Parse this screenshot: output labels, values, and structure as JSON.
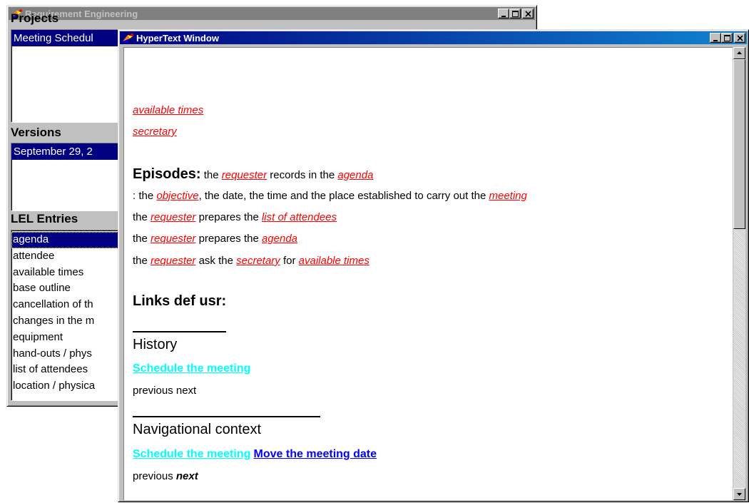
{
  "left_window": {
    "title": "Requirement Engineering",
    "projects_label": "Projects",
    "projects": [
      "Meeting Schedul"
    ],
    "versions_label": "Versions",
    "versions": [
      "September 29, 2"
    ],
    "lel_label": "LEL Entries",
    "lel_entries": [
      "agenda",
      "attendee",
      "available times",
      "base outline",
      "cancellation of th",
      "changes in the m",
      "equipment",
      "hand-outs / phys",
      "list of attendees",
      "location / physica"
    ]
  },
  "hypertext_window": {
    "title": "HyperText Window",
    "top_links": [
      "available times",
      "secretary"
    ],
    "episodes": {
      "label": "Episodes:",
      "line1": {
        "t1": " the ",
        "l1": "requester",
        "t2": " records in the ",
        "l2": "agenda"
      },
      "line2": {
        "t1": ": the ",
        "l1": "objective",
        "t2": ", the date, the time and the place established to carry out the ",
        "l2": "meeting"
      },
      "line3": {
        "t1": "the ",
        "l1": "requester",
        "t2": " prepares the ",
        "l2": "list of attendees"
      },
      "line4": {
        "t1": "the ",
        "l1": "requester",
        "t2": " prepares the ",
        "l2": "agenda"
      },
      "line5": {
        "t1": "the ",
        "l1": "requester",
        "t2": " ask the ",
        "l2": "secretary",
        "t3": " for ",
        "l3": "available times"
      }
    },
    "links_def_label": "Links def usr:",
    "history": {
      "heading": "History",
      "link": "Schedule the meeting",
      "prev": "previous",
      "next": "next"
    },
    "nav_context": {
      "heading": "Navigational context",
      "link1": "Schedule the meeting",
      "link2": "Move the meeting date",
      "prev": "previous",
      "next": "next"
    }
  },
  "colors": {
    "link_red": "#ff0000",
    "link_cyan": "#00ffff",
    "link_blue": "#0000ff",
    "selection": "#000080",
    "active_title": "#000080",
    "inactive_title": "#808080"
  }
}
